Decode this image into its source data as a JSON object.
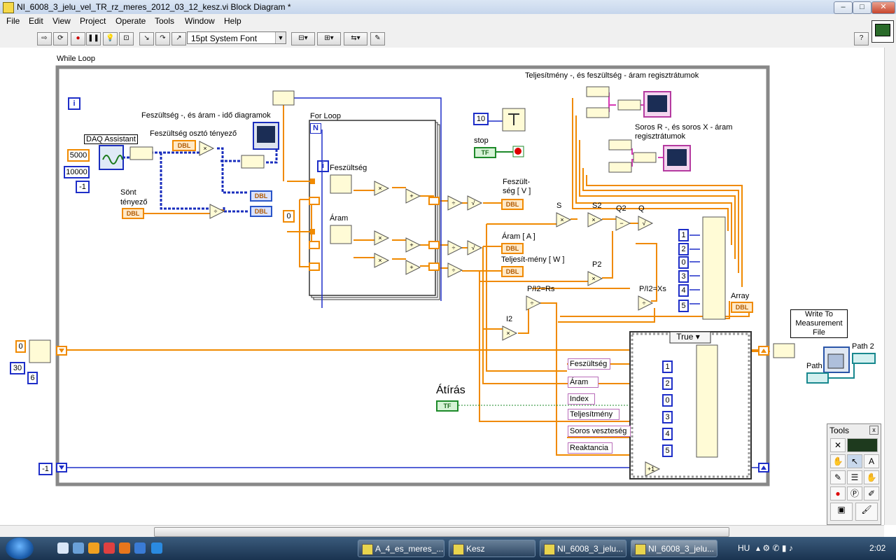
{
  "window": {
    "title": "NI_6008_3_jelu_vel_TR_rz_meres_2012_03_12_kesz.vi Block Diagram *",
    "controls": {
      "minimize": "–",
      "maximize": "□",
      "close": "✕"
    }
  },
  "menu": [
    "File",
    "Edit",
    "View",
    "Project",
    "Operate",
    "Tools",
    "Window",
    "Help"
  ],
  "toolbar": {
    "font_select": "15pt System Font",
    "help_button": "?",
    "icons": [
      "run-arrow-icon",
      "run-continuous-icon",
      "abort-icon",
      "pause-icon",
      "highlight-execution-icon",
      "retain-wire-values-icon",
      "step-into-icon",
      "step-over-icon",
      "step-out-icon",
      "align-icon",
      "distribute-icon",
      "reorder-icon",
      "cleanup-icon"
    ]
  },
  "diagram": {
    "while_loop_label": "While Loop",
    "iteration_terminal": "i",
    "for_loop_label": "For Loop",
    "for_loop_iteration": "i",
    "for_loop_count": "N",
    "daq_assistant": "DAQ Assistant",
    "constants": {
      "c5000": "5000",
      "c10000": "10000",
      "cminus1": "-1",
      "c0_for": "0",
      "c10": "10",
      "c0_left": "0",
      "c30": "30",
      "c6": "6",
      "cminus1_bottom": "-1"
    },
    "labels": {
      "diagram_title_volt_current": "Feszültség -, és áram - idő diagramok",
      "divider_factor": "Feszültség osztó tényező",
      "shunt_factor": "Sönt\ntényező",
      "feszultseg": "Feszültség",
      "aram": "Áram",
      "stop": "stop",
      "feszultseg_v": "Feszült-\nség [ V ]",
      "aram_a": "Áram [ A ]",
      "teljesitmeny_w": "Teljesít-mény [ W ]",
      "s": "S",
      "s2": "S2",
      "q2": "Q2",
      "q": "Q",
      "p2": "P2",
      "p_i2_rs": "P/I2=Rs",
      "p_i2_xs": "P/I2=Xs",
      "i2": "I2",
      "power_voltage_current_registrations": "Teljesítmény -, és feszültség - áram regisztrátumok",
      "series_r_x_current": "Soros R -, és soros X - áram\nregisztrátumok",
      "array": "Array",
      "write_to_file": "Write To\nMeasurement\nFile",
      "path": "Path",
      "path2": "Path 2",
      "atiras": "Átírás",
      "case_true": "True"
    },
    "dbl_tag": "DBL",
    "tf_tag": "TF",
    "array_indices": [
      "1",
      "2",
      "0",
      "3",
      "4",
      "5"
    ],
    "case_indices": [
      "1",
      "2",
      "0",
      "3",
      "4",
      "5"
    ],
    "case_strings": [
      "Feszültség",
      "Áram",
      "Index",
      "Teljesítmény",
      "Soros veszteség",
      "Reaktancia"
    ]
  },
  "tools_palette": {
    "title": "Tools",
    "close": "x"
  },
  "taskbar": {
    "items": [
      "A_4_es_meres_...",
      "Kesz",
      "NI_6008_3_jelu...",
      "NI_6008_3_jelu..."
    ],
    "language": "HU",
    "clock": "2:02"
  }
}
